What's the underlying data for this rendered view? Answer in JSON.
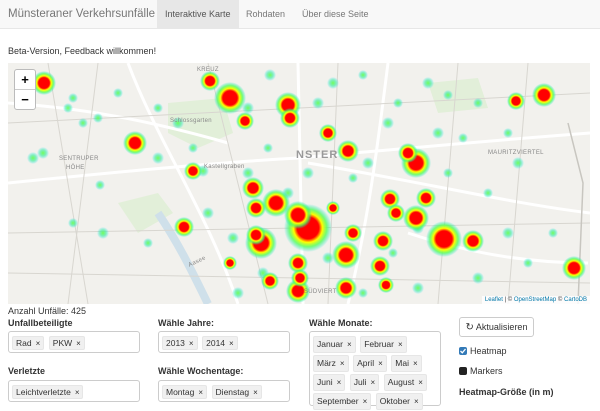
{
  "app": {
    "title": "Münsteraner Verkehrsunfälle"
  },
  "nav": {
    "tabs": [
      {
        "label": "Interaktive Karte",
        "active": true
      },
      {
        "label": "Rohdaten",
        "active": false
      },
      {
        "label": "Über diese Seite",
        "active": false
      }
    ]
  },
  "beta_text": "Beta-Version, Feedback willkommen!",
  "map": {
    "zoom_in": "+",
    "zoom_out": "−",
    "labels": {
      "schlossgarten": "Schlossgarten",
      "kreuzviertel": "KREUZ",
      "sentrup1": "SENTRUPER",
      "sentrup2": "HÖHE",
      "ster": "NSTER",
      "mauritz": "MAURITZVIERTEL",
      "kastell": "Kastellgraben",
      "suedviertel": "SÜDVIERT",
      "aasee": "Aasee"
    },
    "attribution": {
      "leaflet": "Leaflet",
      "sep1": " | © ",
      "osm": "OpenStreetMap",
      "sep2": " © ",
      "carto": "CartoDB"
    }
  },
  "count_text": "Anzahl Unfälle: 425",
  "filters": {
    "unfallbeteiligte": {
      "label": "Unfallbeteiligte",
      "values": [
        "Rad",
        "PKW"
      ]
    },
    "jahre": {
      "label": "Wähle Jahre:",
      "values": [
        "2013",
        "2014"
      ]
    },
    "monate": {
      "label": "Wähle Monate:",
      "values": [
        "Januar",
        "Februar",
        "März",
        "April",
        "Mai",
        "Juni",
        "Juli",
        "August",
        "September",
        "Oktober"
      ]
    },
    "verletzte": {
      "label": "Verletzte",
      "values": [
        "Leichtverletzte"
      ]
    },
    "wochentage": {
      "label": "Wähle Wochentage:",
      "values": [
        "Montag",
        "Dienstag"
      ]
    }
  },
  "controls": {
    "refresh_label": "Aktualisieren",
    "refresh_icon": "refresh-icon",
    "heatmap": {
      "label": "Heatmap",
      "checked": true
    },
    "markers": {
      "label": "Markers",
      "checked": false
    },
    "heatmap_size_label": "Heatmap-Größe (in m)"
  },
  "colors": {
    "accent": "#337ab7",
    "hot": "#ff0000",
    "warm": "#ffff00",
    "cool": "#00e0c0"
  }
}
